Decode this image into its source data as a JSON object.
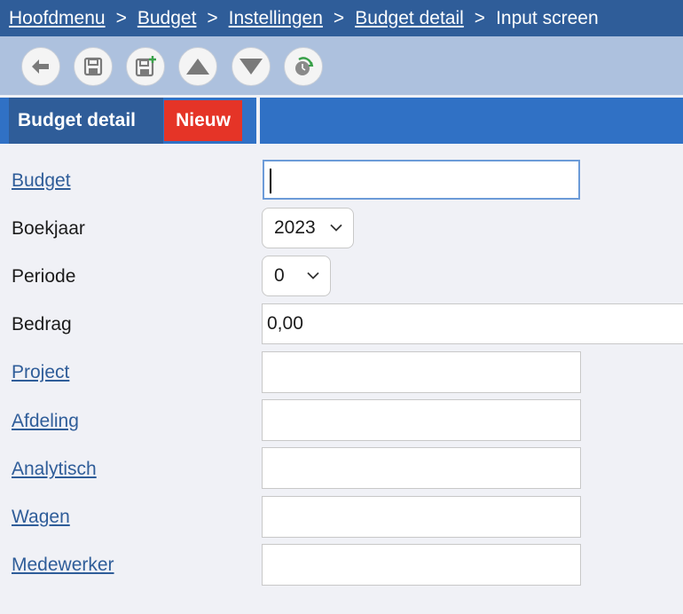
{
  "breadcrumb": {
    "items": [
      "Hoofdmenu",
      "Budget",
      "Instellingen",
      "Budget detail"
    ],
    "current": "Input screen",
    "separator": ">"
  },
  "toolbar": {
    "buttons": [
      "back-arrow-icon",
      "save-icon",
      "save-new-icon",
      "up-arrow-icon",
      "down-arrow-icon",
      "history-icon"
    ]
  },
  "tab": {
    "title": "Budget detail",
    "badge": "Nieuw"
  },
  "form": {
    "budget": {
      "label": "Budget",
      "value": ""
    },
    "boekjaar": {
      "label": "Boekjaar",
      "value": "2023"
    },
    "periode": {
      "label": "Periode",
      "value": "0"
    },
    "bedrag": {
      "label": "Bedrag",
      "value": "0,00"
    },
    "project": {
      "label": "Project",
      "value": ""
    },
    "afdeling": {
      "label": "Afdeling",
      "value": ""
    },
    "analytisch": {
      "label": "Analytisch",
      "value": ""
    },
    "wagen": {
      "label": "Wagen",
      "value": ""
    },
    "medewerker": {
      "label": "Medewerker",
      "value": ""
    }
  },
  "colors": {
    "header": "#2f5d99",
    "toolbar": "#adc1de",
    "tabbar": "#3071c5",
    "badge": "#e53427",
    "link": "#2f5d99",
    "background": "#f0f1f6"
  }
}
